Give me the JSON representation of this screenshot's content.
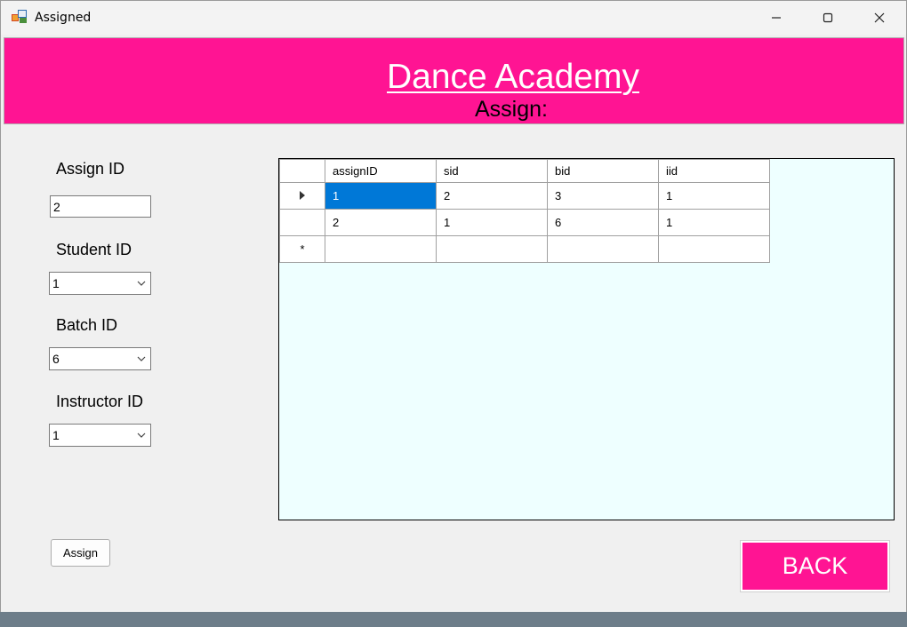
{
  "window": {
    "title": "Assigned"
  },
  "header": {
    "brand": "Dance Academy",
    "subtitle": "Assign:"
  },
  "form": {
    "assign_id_label": "Assign ID",
    "assign_id_value": "2",
    "student_id_label": "Student ID",
    "student_id_value": "1",
    "batch_id_label": "Batch ID",
    "batch_id_value": "6",
    "instructor_id_label": "Instructor ID",
    "instructor_id_value": "1",
    "assign_button": "Assign",
    "back_button": "BACK"
  },
  "grid": {
    "columns": [
      "assignID",
      "sid",
      "bid",
      "iid"
    ],
    "rows": [
      [
        "1",
        "2",
        "3",
        "1"
      ],
      [
        "2",
        "1",
        "6",
        "1"
      ]
    ],
    "new_row_marker": "*"
  },
  "colors": {
    "accent": "#ff1493",
    "grid_background": "#eeffff",
    "selection": "#0078d7"
  }
}
